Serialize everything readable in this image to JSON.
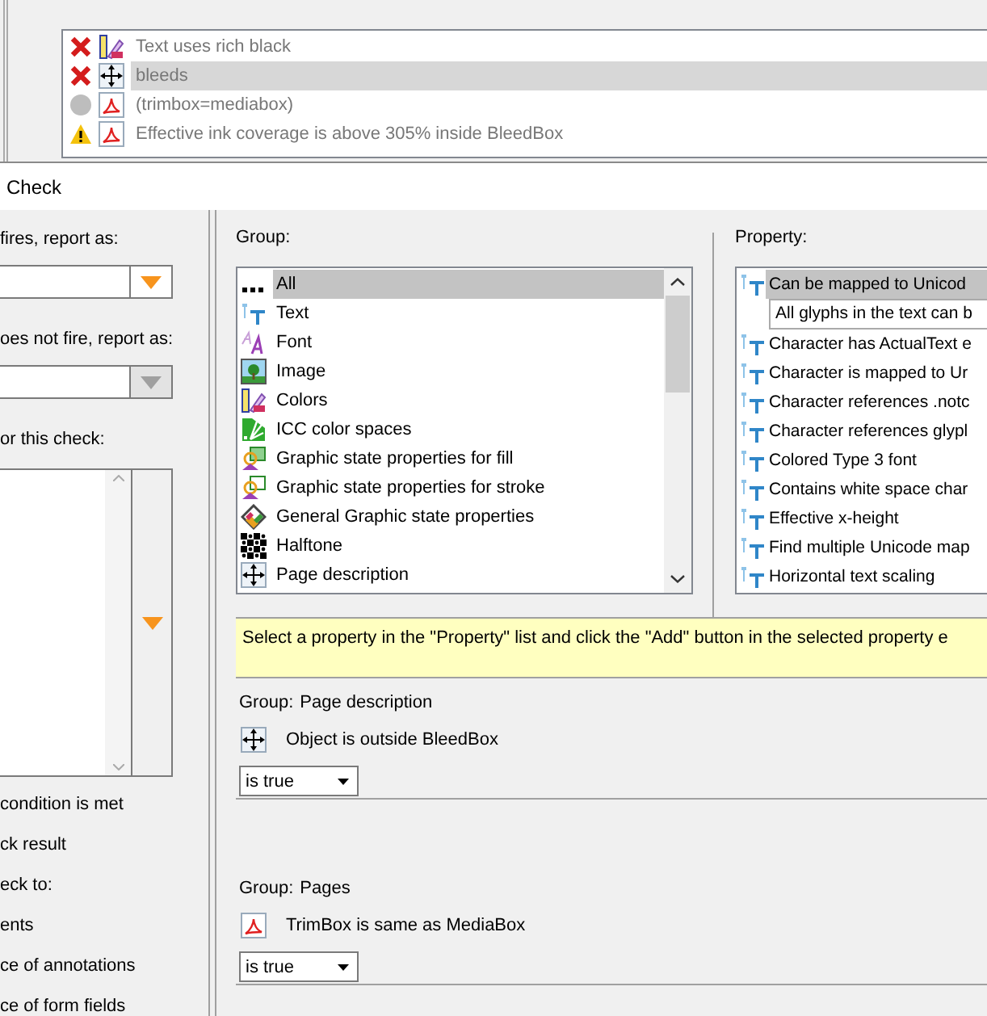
{
  "results": [
    {
      "failed": true,
      "warning": false,
      "kind": "colors",
      "text": "Text uses rich black",
      "selected": false
    },
    {
      "failed": true,
      "warning": false,
      "kind": "page",
      "text": "bleeds",
      "selected": true
    },
    {
      "failed": false,
      "warning": false,
      "kind": "pdf",
      "text": "(trimbox=mediabox)",
      "selected": false
    },
    {
      "failed": false,
      "warning": true,
      "kind": "pdf",
      "text": "Effective ink coverage is above 305% inside BleedBox",
      "selected": false
    }
  ],
  "window": {
    "title": "Check"
  },
  "left": {
    "fires_label": "fires, report as:",
    "fires_select": {
      "accent": true
    },
    "not_fires_label": "oes not fire, report as:",
    "not_fires_select": {
      "accent": false
    },
    "comment_label": "or this check:",
    "options": [
      "condition is met",
      "ck result",
      "eck to:",
      "ents",
      "ce of annotations",
      "ce of form fields"
    ]
  },
  "group": {
    "label": "Group:",
    "items": [
      {
        "kind": "all",
        "label": "All",
        "selected": true
      },
      {
        "kind": "text",
        "label": "Text",
        "selected": false
      },
      {
        "kind": "font",
        "label": "Font",
        "selected": false
      },
      {
        "kind": "image",
        "label": "Image",
        "selected": false
      },
      {
        "kind": "colors",
        "label": "Colors",
        "selected": false
      },
      {
        "kind": "icc",
        "label": "ICC color spaces",
        "selected": false
      },
      {
        "kind": "fill",
        "label": "Graphic state properties for fill",
        "selected": false
      },
      {
        "kind": "stroke",
        "label": "Graphic state properties for stroke",
        "selected": false
      },
      {
        "kind": "general",
        "label": "General Graphic state properties",
        "selected": false
      },
      {
        "kind": "halftone",
        "label": "Halftone",
        "selected": false
      },
      {
        "kind": "page",
        "label": "Page description",
        "selected": false
      }
    ]
  },
  "property": {
    "label": "Property:",
    "items": [
      {
        "kind": "property",
        "label": "Can be mapped to Unicod",
        "selected": true
      },
      {
        "kind": "description",
        "label": "All glyphs in the text can b"
      },
      {
        "kind": "property",
        "label": "Character has ActualText e",
        "selected": false
      },
      {
        "kind": "property",
        "label": "Character is mapped to Ur",
        "selected": false
      },
      {
        "kind": "property",
        "label": "Character references .notc",
        "selected": false
      },
      {
        "kind": "property",
        "label": "Character references glypl",
        "selected": false
      },
      {
        "kind": "property",
        "label": "Colored Type 3 font",
        "selected": false
      },
      {
        "kind": "property",
        "label": "Contains white space char",
        "selected": false
      },
      {
        "kind": "property",
        "label": "Effective x-height",
        "selected": false
      },
      {
        "kind": "property",
        "label": "Find multiple Unicode map",
        "selected": false
      },
      {
        "kind": "property",
        "label": "Horizontal text scaling",
        "selected": false
      }
    ]
  },
  "hint": "Select a property in the \"Property\" list and click the \"Add\" button in the selected property e",
  "conditions": [
    {
      "group_label": "Group:",
      "group": "Page description",
      "kind": "page",
      "property": "Object is outside BleedBox",
      "value": "is true"
    },
    {
      "group_label": "Group:",
      "group": "Pages",
      "kind": "pdf",
      "property": "TrimBox is same as MediaBox",
      "value": "is true"
    }
  ]
}
